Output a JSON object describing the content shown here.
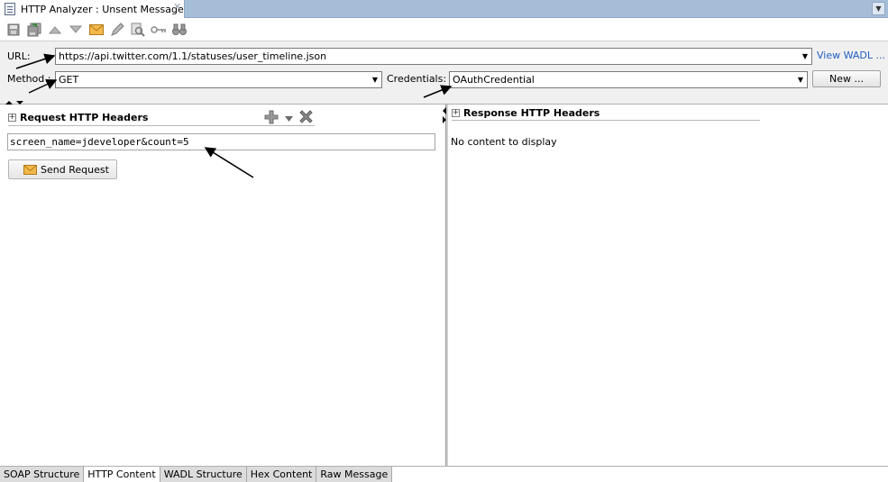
{
  "window": {
    "tab_title": "HTTP Analyzer : Unsent Message",
    "close_glyph": "✕",
    "dropdown_glyph": "▼"
  },
  "toolbar": {
    "icons": [
      "save-icon",
      "save-all-icon",
      "move-up-icon",
      "move-down-icon",
      "envelope-icon",
      "edit-icon",
      "find-icon",
      "key-icon",
      "binoculars-icon"
    ]
  },
  "form": {
    "url_label": "URL:",
    "url_value": "https://api.twitter.com/1.1/statuses/user_timeline.json",
    "view_wadl": "View WADL ...",
    "method_label": "Method :",
    "method_value": "GET",
    "credentials_label": "Credentials:",
    "credentials_value": "OAuthCredential",
    "new_button": "New ..."
  },
  "request": {
    "header_title": "Request HTTP Headers",
    "params_value": "screen_name=jdeveloper&count=5",
    "send_button": "Send Request"
  },
  "response": {
    "header_title": "Response HTTP Headers",
    "empty_text": "No content to display"
  },
  "bottom_tabs": [
    {
      "label": "SOAP Structure"
    },
    {
      "label": "HTTP Content"
    },
    {
      "label": "WADL Structure"
    },
    {
      "label": "Hex Content"
    },
    {
      "label": "Raw Message"
    }
  ],
  "active_bottom_tab": "HTTP Content"
}
